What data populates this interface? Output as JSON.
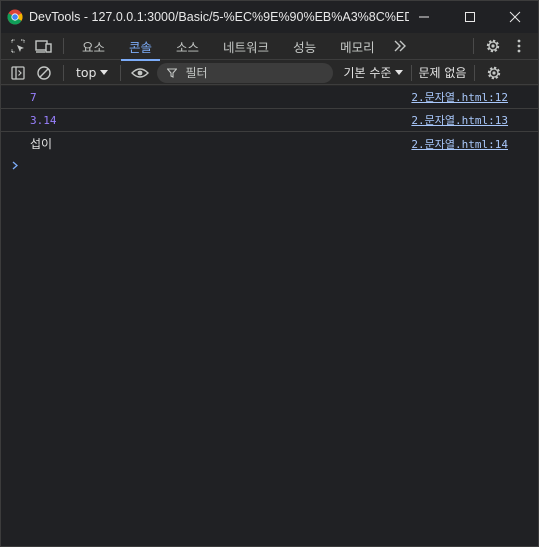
{
  "window": {
    "title": "DevTools - 127.0.0.1:3000/Basic/5-%EC%9E%90%EB%A3%8C%ED%..."
  },
  "tabs": [
    {
      "label": "요소",
      "active": false
    },
    {
      "label": "콘솔",
      "active": true
    },
    {
      "label": "소스",
      "active": false
    },
    {
      "label": "네트워크",
      "active": false
    },
    {
      "label": "성능",
      "active": false
    },
    {
      "label": "메모리",
      "active": false
    }
  ],
  "toolbar": {
    "context": "top",
    "filter_placeholder": "필터",
    "levels": "기본 수준",
    "issues": "문제 없음"
  },
  "console": {
    "messages": [
      {
        "value": "7",
        "type": "number",
        "source": "2.문자열.html:12"
      },
      {
        "value": "3.14",
        "type": "number",
        "source": "2.문자열.html:13"
      },
      {
        "value": "섭이",
        "type": "string",
        "source": "2.문자열.html:14"
      }
    ]
  },
  "colors": {
    "accent": "#7cacf8",
    "number": "#9980ff",
    "link": "#a8c7fa",
    "background": "#202124"
  }
}
